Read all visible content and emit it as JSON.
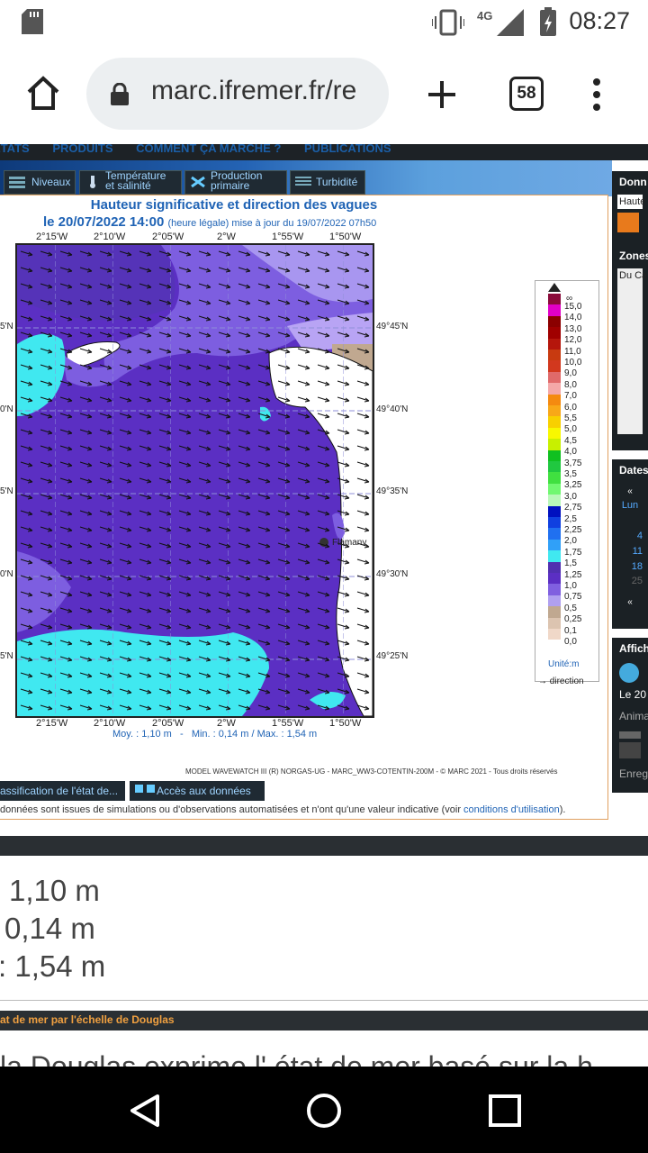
{
  "status": {
    "time": "08:27",
    "network": "4G"
  },
  "browser": {
    "url": "marc.ifremer.fr/re",
    "tab_count": "58"
  },
  "topnav": {
    "items": [
      "ÉTATS",
      "PRODUITS",
      "COMMENT ÇA MARCHE ?",
      "PUBLICATIONS"
    ]
  },
  "tabs": [
    {
      "label": "Niveaux"
    },
    {
      "label_line1": "Température",
      "label_line2": "et salinité"
    },
    {
      "label_line1": "Production",
      "label_line2": "primaire"
    },
    {
      "label": "Turbidité"
    }
  ],
  "map": {
    "title": "Hauteur significative et direction des vagues",
    "date": "le 20/07/2022 14:00",
    "date_note": "(heure légale) mise à jour du 19/07/2022 07h50",
    "lon_labels": [
      "2°15'W",
      "2°10'W",
      "2°05'W",
      "2°W",
      "1°55'W",
      "1°50'W"
    ],
    "lat_right": [
      "49°45'N",
      "49°40'N",
      "49°35'N",
      "49°30'N",
      "49°25'N"
    ],
    "lat_left": [
      "5'N",
      "0'N",
      "5'N",
      "0'N",
      "5'N"
    ],
    "place": "Flamanv",
    "stats_line": "Moy. : 1,10 m   -   Min. : 0,14 m / Max. : 1,54 m",
    "credit": "MODEL WAVEWATCH III (R) NORGAS-UG - MARC_WW3-COTENTIN-200M - © MARC 2021 - Tous droits réservés"
  },
  "legend": {
    "infinity": "∞",
    "labels": [
      "15,0",
      "14,0",
      "13,0",
      "12,0",
      "11,0",
      "10,0",
      "9,0",
      "8,0",
      "7,0",
      "6,0",
      "5,5",
      "5,0",
      "4,5",
      "4,0",
      "3,75",
      "3,5",
      "3,25",
      "3,0",
      "2,75",
      "2,5",
      "2,25",
      "2,0",
      "1,75",
      "1,5",
      "1,25",
      "1,0",
      "0,75",
      "0,5",
      "0,25",
      "0,1",
      "0,0"
    ],
    "colors": [
      "#8a0b3a",
      "#e000c8",
      "#8b0000",
      "#a00000",
      "#b5160c",
      "#c83a10",
      "#d2381e",
      "#e06a6a",
      "#f4a8a8",
      "#f48a10",
      "#f8a818",
      "#f8d000",
      "#f8f800",
      "#c8f000",
      "#10c020",
      "#20c840",
      "#40e040",
      "#70f870",
      "#b8f8b8",
      "#0010c0",
      "#1040e0",
      "#2070f0",
      "#30a0f8",
      "#40e8f0",
      "#5030b0",
      "#5b2fc3",
      "#8060e0",
      "#b0a0f0",
      "#c0a890",
      "#dcc4b0",
      "#f0d8c8"
    ],
    "unit": "Unité:m",
    "direction": "direction"
  },
  "actions": {
    "classification": "assification de l'état de...",
    "access": "Accès aux données"
  },
  "disclaimer": {
    "text": "données sont issues de simulations ou d'observations automatisées et n'ont qu'une valeur indicative (voir ",
    "link": "conditions d'utilisation",
    "end": ")."
  },
  "sidebar": {
    "donnees": "Donn",
    "hauteur": "Haute",
    "zones": "Zones",
    "zone_val": "Du Ca",
    "dates": "Dates",
    "day": "Lun",
    "nums": [
      "4",
      "11",
      "18",
      "25"
    ],
    "affich": "Affich",
    "le": "Le 20",
    "anim": "Anima",
    "enreg": "Enreg"
  },
  "stats": {
    "moy": "1,10 m",
    "min": "0,14 m",
    "max": ": 1,54 m"
  },
  "douglas": {
    "title": "at de mer par l'échelle de Douglas"
  },
  "partial_text": "la Douglas exprime l' état de mer basé sur la h"
}
